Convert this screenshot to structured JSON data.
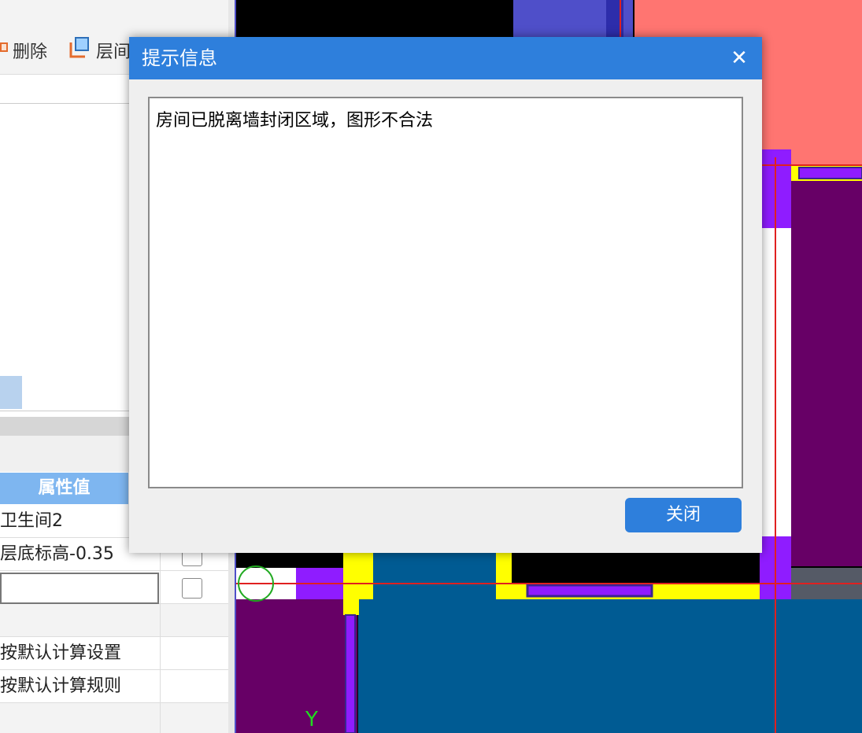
{
  "toolbar": {
    "delete_label": "删除",
    "layer_label": "层间"
  },
  "properties": {
    "header_value": "属性值",
    "rows": [
      {
        "value": "卫生间2"
      },
      {
        "value": "层底标高-0.35"
      },
      {
        "value": ""
      },
      {
        "value": ""
      },
      {
        "value": "按默认计算设置"
      },
      {
        "value": "按默认计算规则"
      }
    ]
  },
  "canvas": {
    "axis_label": "Y"
  },
  "dialog": {
    "title": "提示信息",
    "close_icon": "close-icon",
    "message": "房间已脱离墙封闭区域，图形不合法",
    "close_button": "关闭"
  },
  "colors": {
    "dialog_title_bg": "#2e7fdc",
    "salmon": "#ff7571",
    "purple_room": "#670066",
    "blue_room": "#005b93",
    "wall_violet": "#8f1cff",
    "wall_yellow": "#ffff00",
    "axis_red": "#e02020",
    "prop_header_bg": "#7eb6f0"
  }
}
